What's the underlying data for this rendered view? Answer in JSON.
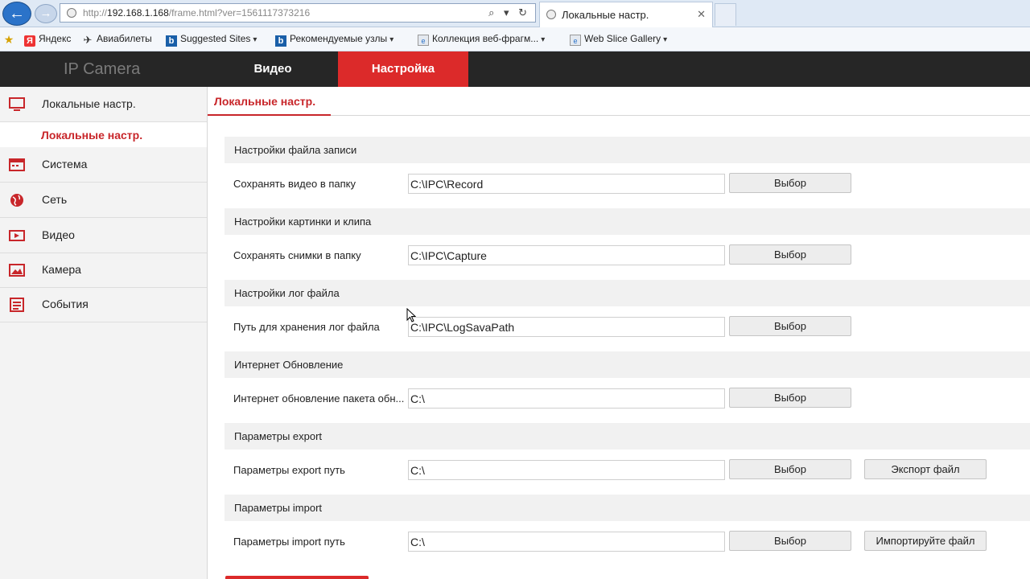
{
  "browser": {
    "url_prefix": "http://",
    "url_host": "192.168.1.168",
    "url_path": "/frame.html?ver=1561117373216",
    "url_controls": "⌕ ▾ ↻",
    "tab_title": "Локальные настр.",
    "tab_close": "✕",
    "back_glyph": "←",
    "forward_glyph": "→",
    "favorites": [
      {
        "icon": "favorites-star-icon",
        "glyph": "★",
        "label": ""
      },
      {
        "icon": "yandex-icon",
        "glyph": "Я",
        "label": "Яндекс"
      },
      {
        "icon": "plane-icon",
        "glyph": "✈",
        "label": "Авиабилеты"
      },
      {
        "icon": "bing-icon",
        "glyph": "b",
        "label": "Suggested Sites"
      },
      {
        "icon": "bing-icon",
        "glyph": "b",
        "label": "Рекомендуемые узлы"
      },
      {
        "icon": "ie-icon",
        "glyph": "e",
        "label": "Коллекция веб-фрагм..."
      },
      {
        "icon": "ie-icon",
        "glyph": "e",
        "label": "Web Slice Gallery"
      }
    ],
    "caret": "▾"
  },
  "header": {
    "brand": "IP Camera",
    "tabs": [
      {
        "label": "Видео",
        "active": false
      },
      {
        "label": "Настройка",
        "active": true
      }
    ]
  },
  "sidebar": {
    "items": [
      {
        "label": "Локальные настр.",
        "icon": "monitor-icon"
      },
      {
        "label": "Система",
        "icon": "system-icon"
      },
      {
        "label": "Сеть",
        "icon": "globe-icon"
      },
      {
        "label": "Видео",
        "icon": "video-icon"
      },
      {
        "label": "Камера",
        "icon": "image-icon"
      },
      {
        "label": "События",
        "icon": "events-icon"
      }
    ],
    "active_sub": "Локальные настр."
  },
  "main": {
    "tab": "Локальные настр.",
    "sections": [
      {
        "title": "Настройки файла записи",
        "label": "Сохранять видео в папку",
        "value": "C:\\IPC\\Record",
        "button": "Выбор"
      },
      {
        "title": "Настройки картинки и клипа",
        "label": "Сохранять снимки в папку",
        "value": "C:\\IPC\\Capture",
        "button": "Выбор"
      },
      {
        "title": "Настройки лог файла",
        "label": "Путь для хранения лог файла",
        "value": "C:\\IPC\\LogSavaPath",
        "button": "Выбор"
      },
      {
        "title": "Интернет Обновление",
        "label": "Интернет обновление пакета обн...",
        "value": "C:\\",
        "button": "Выбор"
      },
      {
        "title": "Параметры export",
        "label": "Параметры export путь",
        "value": "C:\\",
        "button": "Выбор",
        "extra_button": "Экспорт файл"
      },
      {
        "title": "Параметры import",
        "label": "Параметры import путь",
        "value": "C:\\",
        "button": "Выбор",
        "extra_button": "Импортируйте файл"
      }
    ]
  },
  "colors": {
    "accent": "#dc2a2a",
    "header_bg": "#262626",
    "active_text": "#c8262a"
  }
}
